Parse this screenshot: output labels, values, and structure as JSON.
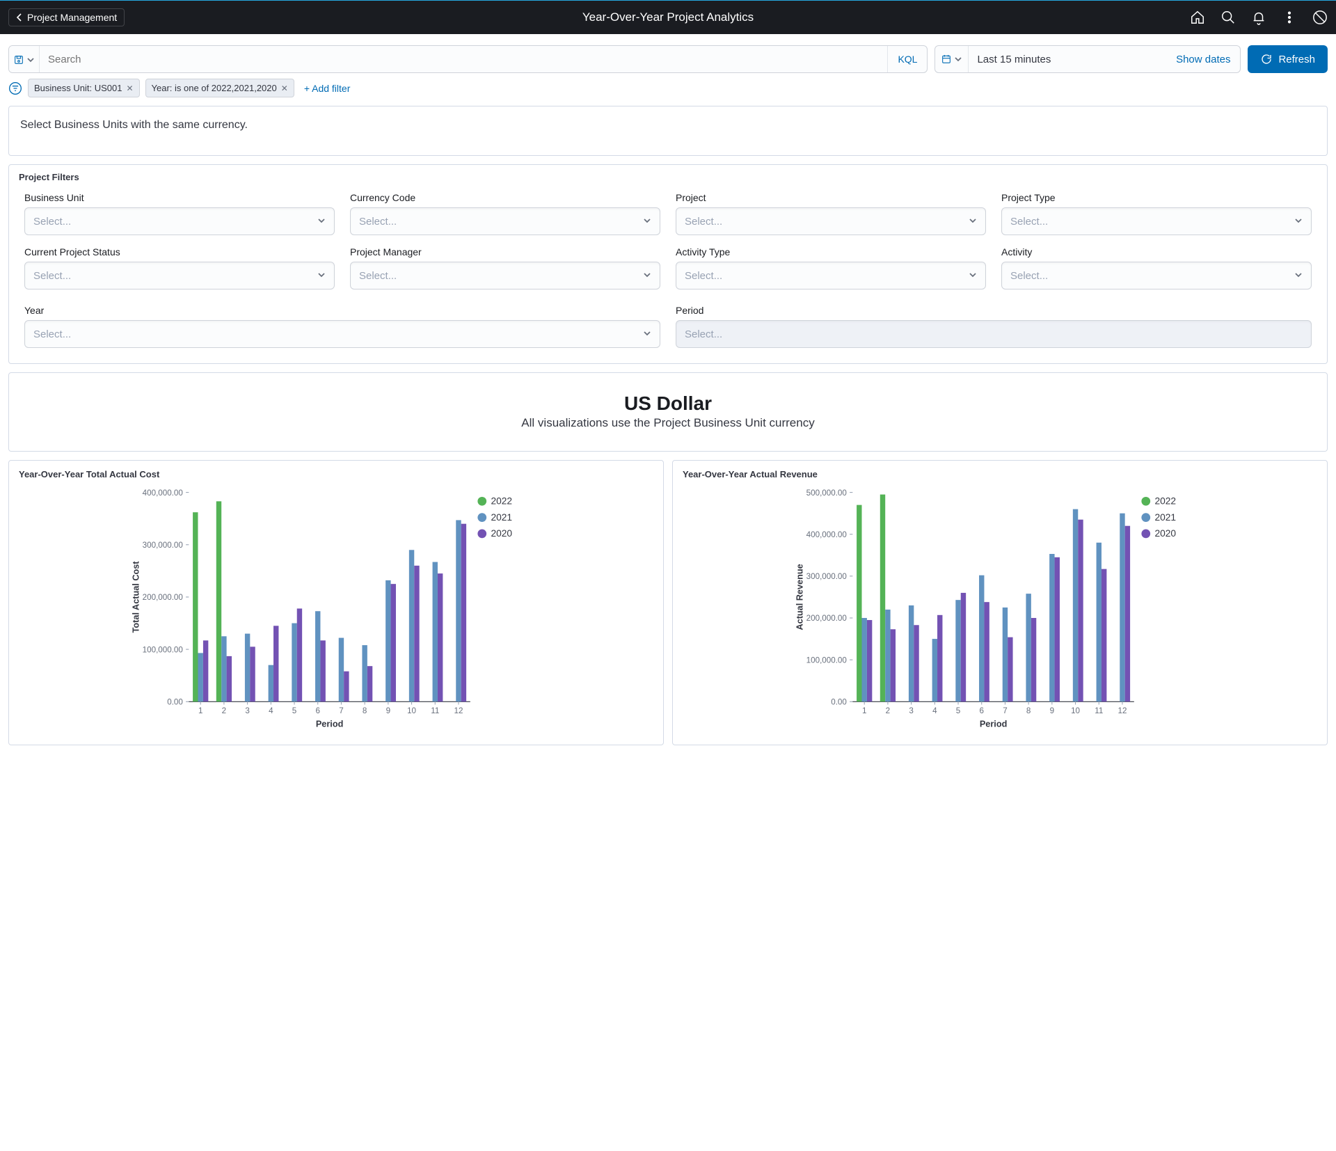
{
  "topbar": {
    "back_label": "Project Management",
    "title": "Year-Over-Year Project Analytics"
  },
  "query": {
    "search_placeholder": "Search",
    "kql_label": "KQL",
    "time_label": "Last 15 minutes",
    "show_dates_label": "Show dates",
    "refresh_label": "Refresh"
  },
  "filters": {
    "pills": [
      "Business Unit: US001",
      "Year: is one of 2022,2021,2020"
    ],
    "add_filter_label": "+ Add filter"
  },
  "info_text": "Select Business Units with the same currency.",
  "project_filters": {
    "title": "Project Filters",
    "fields": {
      "business_unit": {
        "label": "Business Unit",
        "placeholder": "Select..."
      },
      "currency_code": {
        "label": "Currency Code",
        "placeholder": "Select..."
      },
      "project": {
        "label": "Project",
        "placeholder": "Select..."
      },
      "project_type": {
        "label": "Project Type",
        "placeholder": "Select..."
      },
      "current_status": {
        "label": "Current Project Status",
        "placeholder": "Select..."
      },
      "project_manager": {
        "label": "Project Manager",
        "placeholder": "Select..."
      },
      "activity_type": {
        "label": "Activity Type",
        "placeholder": "Select..."
      },
      "activity": {
        "label": "Activity",
        "placeholder": "Select..."
      },
      "year": {
        "label": "Year",
        "placeholder": "Select..."
      },
      "period": {
        "label": "Period",
        "placeholder": "Select..."
      }
    }
  },
  "currency": {
    "title": "US Dollar",
    "subtitle": "All visualizations use the Project Business Unit currency"
  },
  "chart_data": [
    {
      "type": "bar",
      "id": "yoy_total_actual_cost",
      "title": "Year-Over-Year Total Actual Cost",
      "xlabel": "Period",
      "ylabel": "Total Actual Cost",
      "ylim": [
        0,
        400000
      ],
      "yticks": [
        "0.00",
        "100,000.00",
        "200,000.00",
        "300,000.00",
        "400,000.00"
      ],
      "categories": [
        "1",
        "2",
        "3",
        "4",
        "5",
        "6",
        "7",
        "8",
        "9",
        "10",
        "11",
        "12"
      ],
      "series": [
        {
          "name": "2022",
          "color": "#54b356",
          "values": [
            362000,
            383000,
            null,
            null,
            null,
            null,
            null,
            null,
            null,
            null,
            null,
            null
          ]
        },
        {
          "name": "2021",
          "color": "#6092c0",
          "values": [
            93000,
            125000,
            130000,
            70000,
            150000,
            173000,
            122000,
            108000,
            232000,
            290000,
            267000,
            347000
          ]
        },
        {
          "name": "2020",
          "color": "#7352b3",
          "values": [
            117000,
            87000,
            105000,
            145000,
            178000,
            117000,
            58000,
            68000,
            225000,
            260000,
            245000,
            340000
          ]
        }
      ]
    },
    {
      "type": "bar",
      "id": "yoy_actual_revenue",
      "title": "Year-Over-Year Actual Revenue",
      "xlabel": "Period",
      "ylabel": "Actual Revenue",
      "ylim": [
        0,
        500000
      ],
      "yticks": [
        "0.00",
        "100,000.00",
        "200,000.00",
        "300,000.00",
        "400,000.00",
        "500,000.00"
      ],
      "categories": [
        "1",
        "2",
        "3",
        "4",
        "5",
        "6",
        "7",
        "8",
        "9",
        "10",
        "11",
        "12"
      ],
      "series": [
        {
          "name": "2022",
          "color": "#54b356",
          "values": [
            470000,
            495000,
            null,
            null,
            null,
            null,
            null,
            null,
            null,
            null,
            null,
            null
          ]
        },
        {
          "name": "2021",
          "color": "#6092c0",
          "values": [
            200000,
            220000,
            230000,
            150000,
            243000,
            302000,
            225000,
            258000,
            353000,
            460000,
            380000,
            450000
          ]
        },
        {
          "name": "2020",
          "color": "#7352b3",
          "values": [
            195000,
            173000,
            183000,
            207000,
            260000,
            238000,
            154000,
            200000,
            345000,
            435000,
            317000,
            420000
          ]
        }
      ]
    }
  ]
}
